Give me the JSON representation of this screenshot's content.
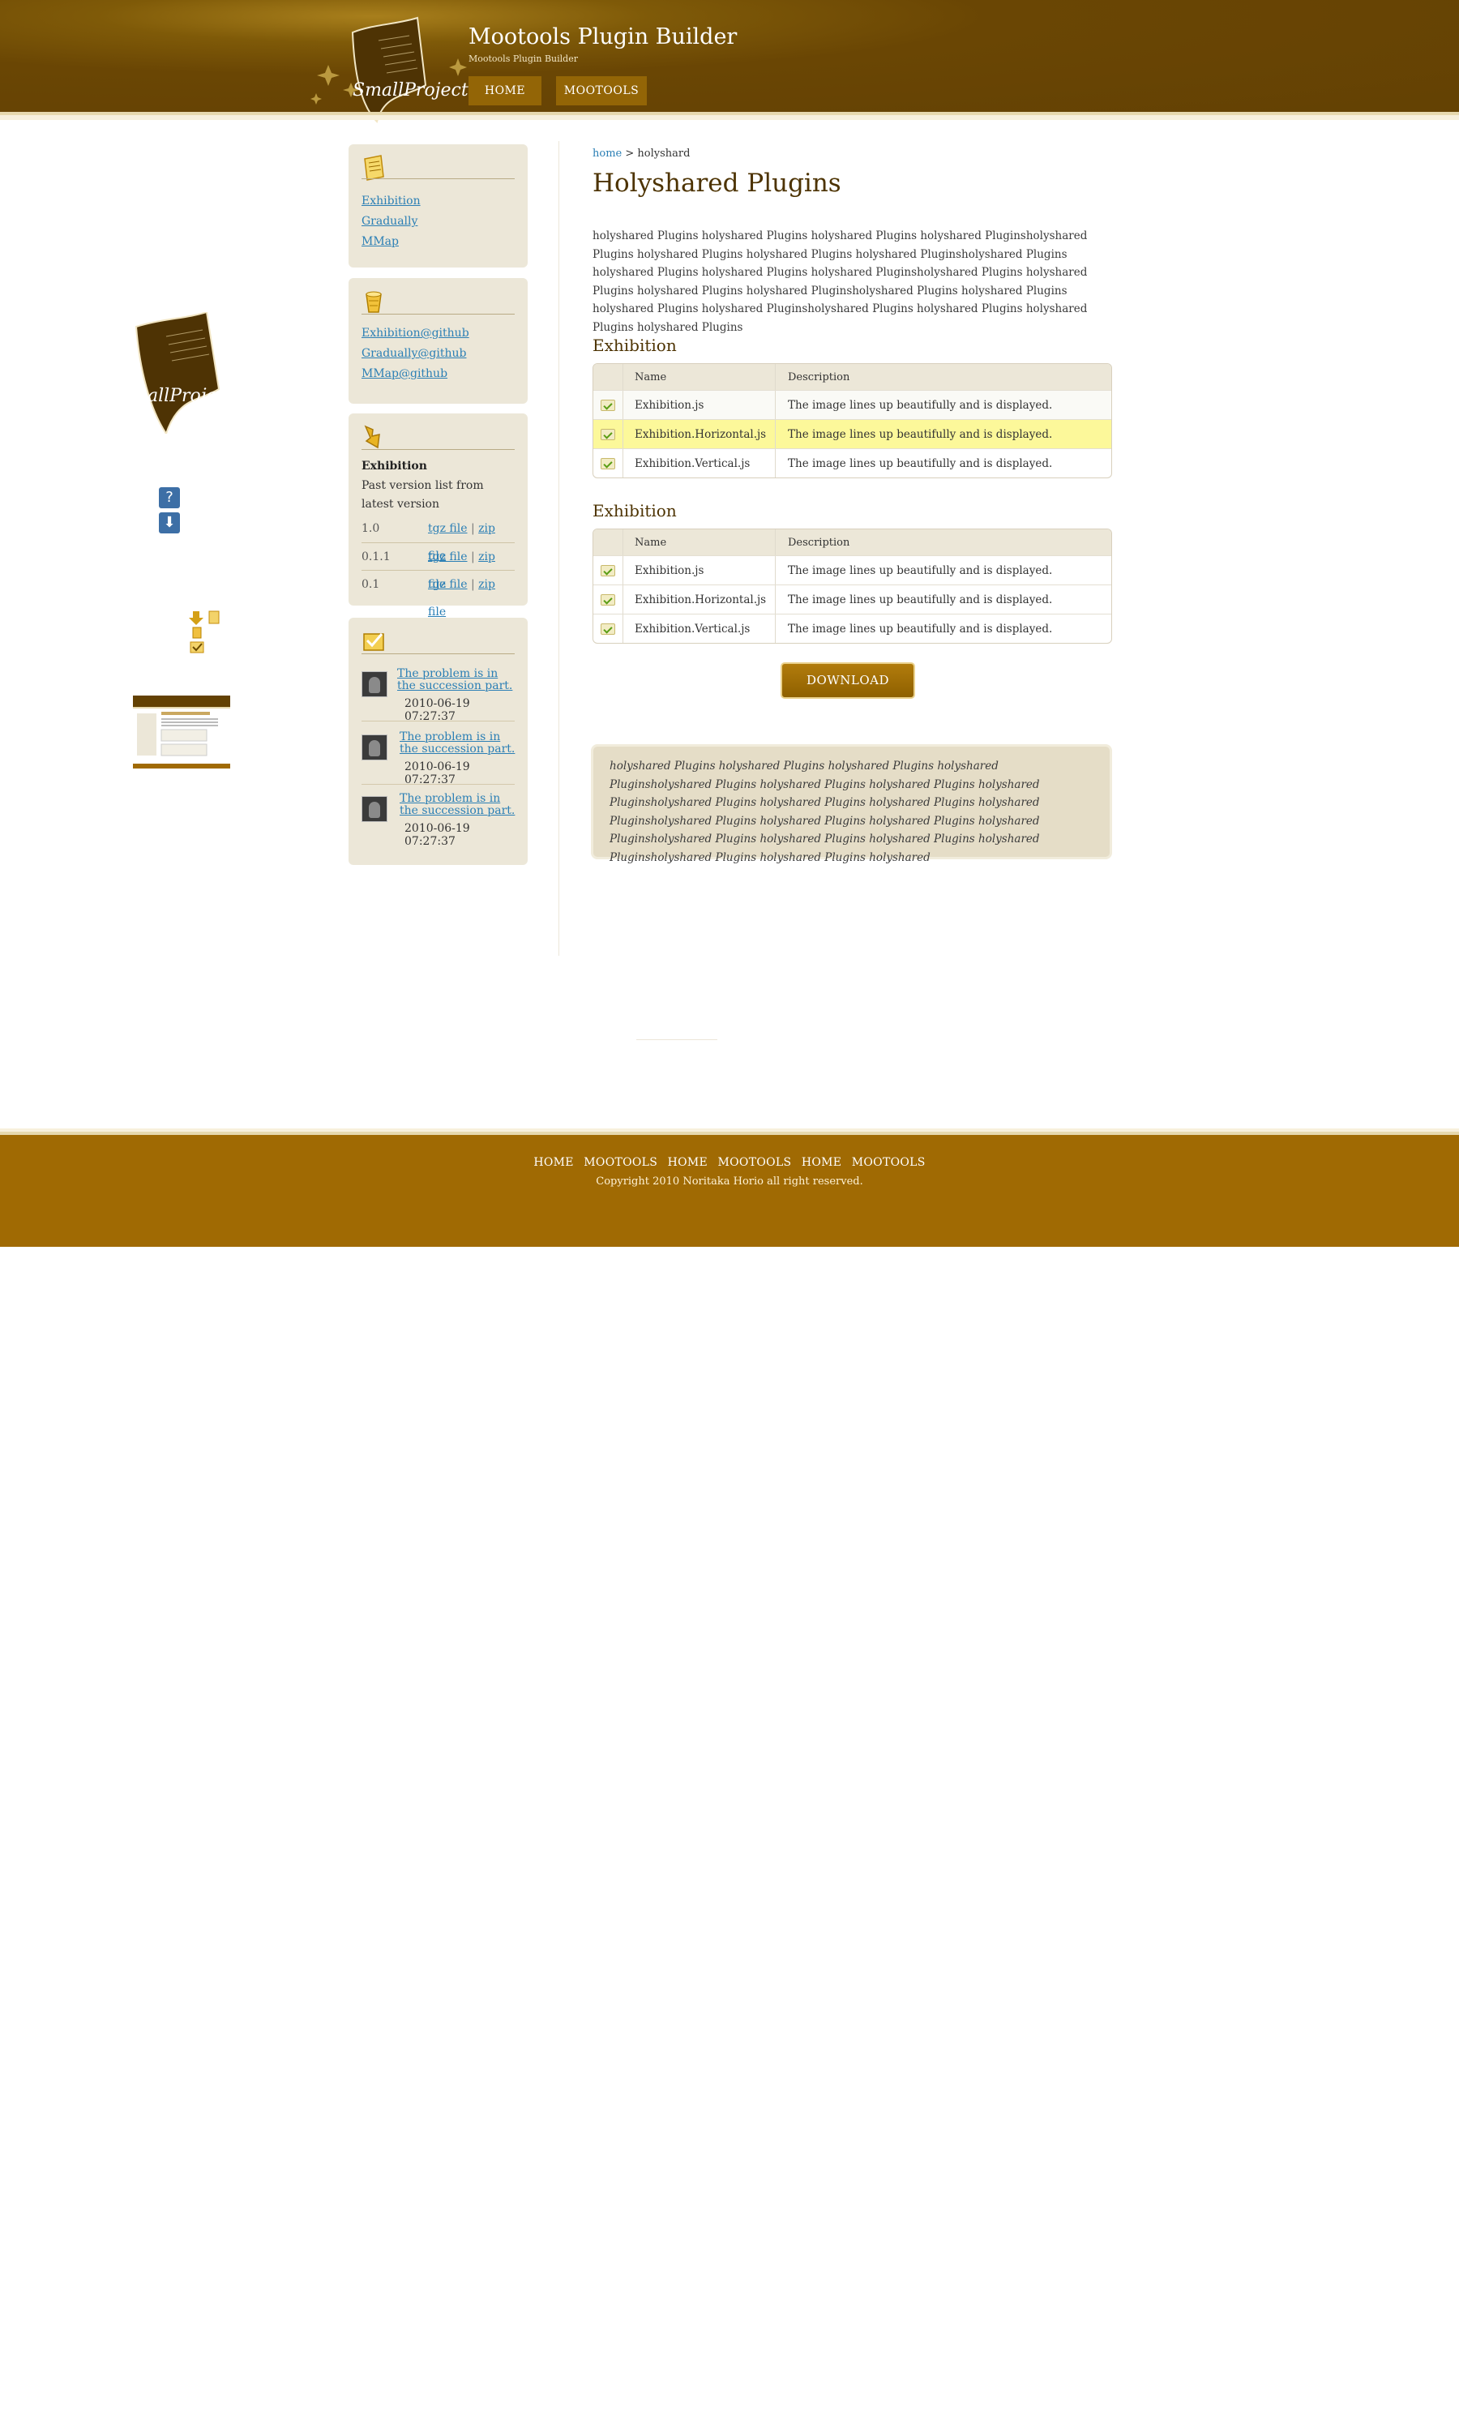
{
  "header": {
    "logo_text": "SmallProject",
    "title": "Mootools Plugin Builder",
    "subtitle": "Mootools Plugin Builder",
    "nav": [
      {
        "label": "HOME"
      },
      {
        "label": "MOOTOOLS"
      }
    ]
  },
  "floating": {
    "logo_text": "allProje",
    "help_glyph": "?",
    "download_glyph": "⬇"
  },
  "sidebar": {
    "box1": {
      "icon": "document-icon",
      "links": [
        "Exhibition",
        "Gradually",
        "MMap"
      ]
    },
    "box2": {
      "icon": "cup-icon",
      "links": [
        "Exhibition@github",
        "Gradually@github",
        "MMap@github"
      ]
    },
    "box3": {
      "icon": "download-arrow-icon",
      "title": "Exhibition",
      "description": "Past version list from latest version",
      "versions": [
        {
          "version": "1.0",
          "tgz": "tgz file",
          "sep": "|",
          "zip": "zip file"
        },
        {
          "version": "0.1.1",
          "tgz": "tgz file",
          "sep": "|",
          "zip": "zip file"
        },
        {
          "version": "0.1",
          "tgz": "tgz file",
          "sep": "|",
          "zip": "zip file"
        }
      ]
    },
    "box4": {
      "icon": "checkmark-mail-icon",
      "posts": [
        {
          "title": "The problem is in the succession part.",
          "date": "2010-06-19 07:27:37"
        },
        {
          "title": "The problem is in the succession part.",
          "date": "2010-06-19 07:27:37"
        },
        {
          "title": "The problem is in the succession part.",
          "date": "2010-06-19 07:27:37"
        }
      ]
    }
  },
  "main": {
    "breadcrumb": {
      "home": "home",
      "sep": " > ",
      "current": "holyshard"
    },
    "title": "Holyshared Plugins",
    "intro": "holyshared Plugins holyshared Plugins holyshared Plugins holyshared Pluginsholyshared Plugins holyshared Plugins holyshared Plugins holyshared Pluginsholyshared Plugins holyshared Plugins holyshared Plugins holyshared Pluginsholyshared Plugins holyshared Plugins holyshared Plugins holyshared Pluginsholyshared Plugins holyshared Plugins holyshared Plugins holyshared Pluginsholyshared Plugins holyshared Plugins holyshared Plugins holyshared Plugins",
    "sections": [
      {
        "title": "Exhibition",
        "headers": {
          "name": "Name",
          "description": "Description"
        },
        "rows": [
          {
            "name": "Exhibition.js",
            "description": "The image lines up beautifully and is displayed."
          },
          {
            "name": "Exhibition.Horizontal.js",
            "description": "The image lines up beautifully and is displayed."
          },
          {
            "name": "Exhibition.Vertical.js",
            "description": "The image lines up beautifully and is displayed."
          }
        ]
      },
      {
        "title": "Exhibition",
        "headers": {
          "name": "Name",
          "description": "Description"
        },
        "rows": [
          {
            "name": "Exhibition.js",
            "description": "The image lines up beautifully and is displayed."
          },
          {
            "name": "Exhibition.Horizontal.js",
            "description": "The image lines up beautifully and is displayed."
          },
          {
            "name": "Exhibition.Vertical.js",
            "description": "The image lines up beautifully and is displayed."
          }
        ]
      }
    ],
    "download_label": "DOWNLOAD",
    "quote": "holyshared Plugins holyshared Plugins holyshared Plugins holyshared Pluginsholyshared Plugins holyshared Plugins holyshared Plugins holyshared Pluginsholyshared Plugins holyshared Plugins holyshared Plugins holyshared Pluginsholyshared Plugins holyshared Plugins holyshared Plugins holyshared Pluginsholyshared Plugins holyshared Plugins holyshared Plugins holyshared Pluginsholyshared Plugins holyshared Plugins holyshared"
  },
  "footer": {
    "nav": [
      "HOME",
      "MOOTOOLS",
      "HOME",
      "MOOTOOLS",
      "HOME",
      "MOOTOOLS"
    ],
    "copyright": "Copyright 2010 Noritaka Horio all right reserved."
  },
  "colors": {
    "header_brown": "#634103",
    "footer_gold": "#a06a03",
    "nav_button": "#936506",
    "link_blue": "#2b7fb5",
    "title_brown": "#4d3302",
    "sidebar_bg": "#ece7d8",
    "highlight_row": "#fcf89a"
  }
}
